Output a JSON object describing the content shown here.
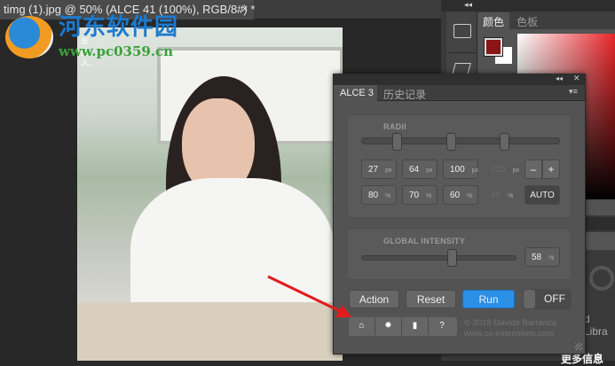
{
  "document": {
    "tab_title": "timg (1).jpg @ 50% (ALCE 41 (100%), RGB/8#) *",
    "close": "×",
    "photo_caption": "年 夏 入。"
  },
  "watermark": {
    "site_name": "河东软件园",
    "url": "www.pc0359.cn"
  },
  "color_panel": {
    "tabs": [
      "颜色",
      "色板"
    ],
    "foreground": "#8b1414",
    "background": "#ffffff",
    "collapse": "◂◂"
  },
  "alce": {
    "collapse": "◂◂",
    "close": "✕",
    "tabs": [
      "ALCE 3",
      "历史记录"
    ],
    "menu": "▾≡",
    "radii_label": "RADII",
    "radii_slider": [
      0.18,
      0.45,
      0.72
    ],
    "row1": [
      {
        "v": "27",
        "u": "px"
      },
      {
        "v": "64",
        "u": "px"
      },
      {
        "v": "100",
        "u": "px"
      },
      {
        "v": "225",
        "u": "px"
      }
    ],
    "row2": [
      {
        "v": "80",
        "u": "%"
      },
      {
        "v": "70",
        "u": "%"
      },
      {
        "v": "60",
        "u": "%"
      },
      {
        "v": "40",
        "u": "%"
      }
    ],
    "minus": "–",
    "plus": "+",
    "auto": "AUTO",
    "intensity_label": "GLOBAL INTENSITY",
    "intensity_value": "58",
    "intensity_unit": "%",
    "intensity_fraction": 0.58,
    "buttons": {
      "action": "Action",
      "reset": "Reset",
      "run": "Run",
      "toggle": "OFF"
    },
    "accent": "#2b8fe6",
    "copyright": "© 2018 Davide Barranca",
    "website": "www.cc-extensions.com"
  },
  "right_panel": {
    "libraries_fragment": "d Libra",
    "more_info": "更多信息"
  }
}
